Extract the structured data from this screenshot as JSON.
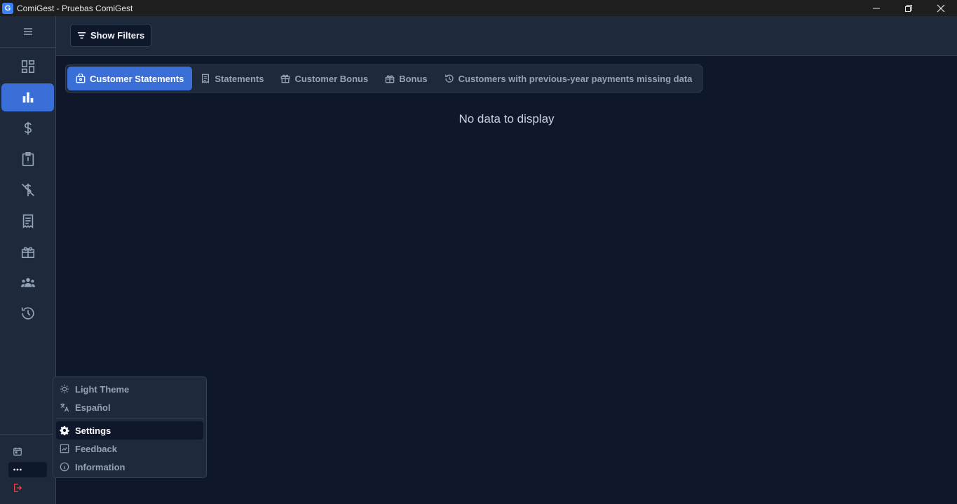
{
  "window": {
    "title": "ComiGest - Pruebas ComiGest",
    "logo_letter": "G"
  },
  "header": {
    "show_filters_label": "Show Filters"
  },
  "tabs": [
    {
      "label": "Customer Statements",
      "icon": "customer-statements-icon",
      "active": true
    },
    {
      "label": "Statements",
      "icon": "statements-icon",
      "active": false
    },
    {
      "label": "Customer Bonus",
      "icon": "gift-icon",
      "active": false
    },
    {
      "label": "Bonus",
      "icon": "bonus-icon",
      "active": false
    },
    {
      "label": "Customers with previous-year payments missing data",
      "icon": "history-icon",
      "active": false
    }
  ],
  "main": {
    "empty_message": "No data to display"
  },
  "sidebar": {
    "items": [
      "dashboard-icon",
      "bar-chart-icon",
      "dollar-icon",
      "alert-clipboard-icon",
      "no-payment-icon",
      "receipt-icon",
      "gift-box-icon",
      "users-icon",
      "history-icon"
    ],
    "active_index": 1,
    "bottom": [
      "calendar-icon",
      "more-icon",
      "logout-icon"
    ]
  },
  "popup_menu": {
    "items": [
      {
        "label": "Light Theme",
        "icon": "sun-icon"
      },
      {
        "label": "Español",
        "icon": "translate-icon"
      },
      {
        "label": "Settings",
        "icon": "gear-icon",
        "active": true
      },
      {
        "label": "Feedback",
        "icon": "feedback-icon"
      },
      {
        "label": "Information",
        "icon": "info-icon"
      }
    ]
  },
  "colors": {
    "accent": "#3b6fd8",
    "background": "#0f172a",
    "panel": "#1e293b",
    "danger": "#ef4444"
  }
}
